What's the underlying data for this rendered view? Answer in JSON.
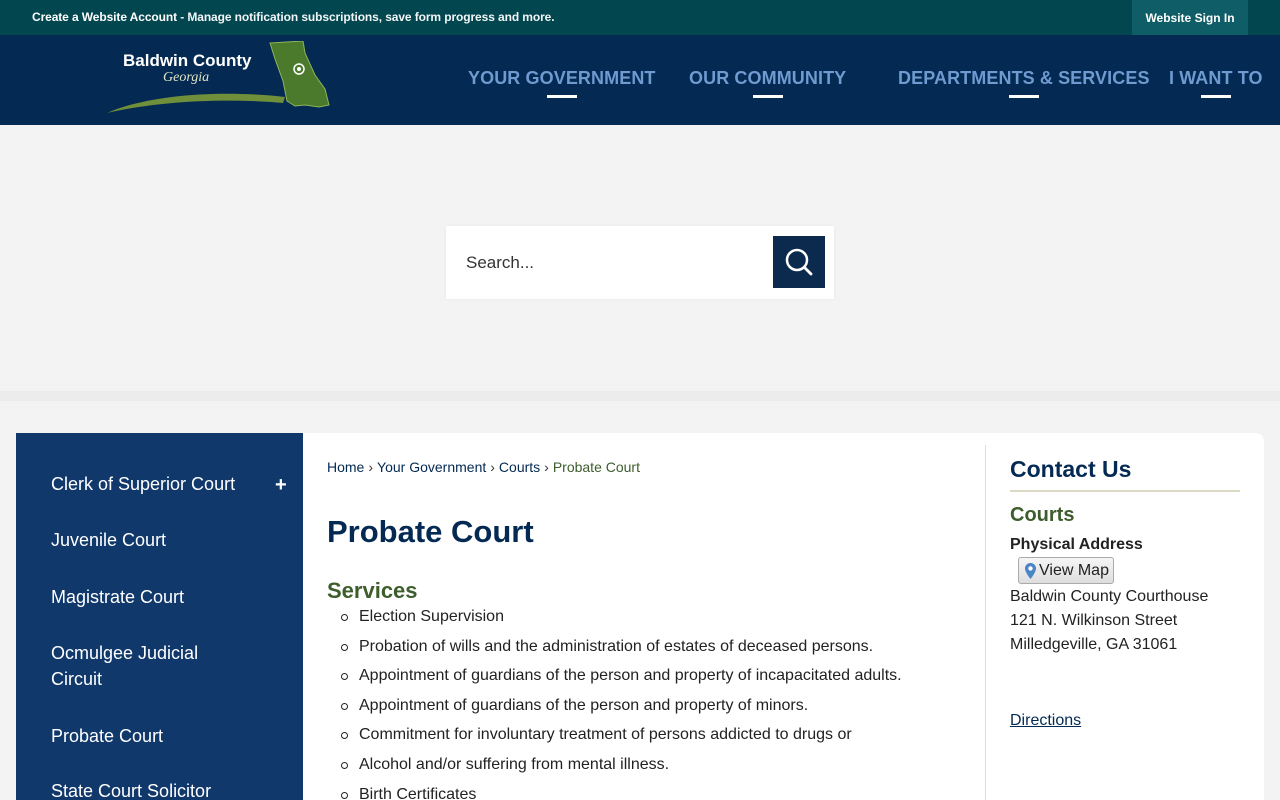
{
  "topbar": {
    "account_link": "Create a Website Account",
    "account_desc": " - Manage notification subscriptions, save form progress and more.",
    "signin": "Website Sign In"
  },
  "logo": {
    "line1": "Baldwin County",
    "line2": "Georgia"
  },
  "nav": {
    "items": [
      {
        "label": "YOUR GOVERNMENT"
      },
      {
        "label": "OUR COMMUNITY"
      },
      {
        "label": "DEPARTMENTS & SERVICES"
      },
      {
        "label": "I WANT TO"
      }
    ]
  },
  "search": {
    "placeholder": "Search..."
  },
  "sidebar": {
    "items": [
      {
        "label": "Clerk of Superior Court",
        "expandable": "+"
      },
      {
        "label": "Juvenile Court"
      },
      {
        "label": "Magistrate Court"
      },
      {
        "label": "Ocmulgee Judicial Circuit"
      },
      {
        "label": "Probate Court"
      },
      {
        "label": "State Court Solicitor"
      }
    ]
  },
  "breadcrumb": {
    "items": [
      "Home",
      "Your Government",
      "Courts"
    ],
    "separator": "›",
    "current": "Probate Court"
  },
  "page": {
    "title": "Probate Court",
    "section": "Services",
    "services": [
      "Election Supervision",
      "Probation of wills and the administration of estates of deceased persons.",
      "Appointment of guardians of the person and property of incapacitated adults.",
      "Appointment of guardians of the person and property of minors.",
      "Commitment for involuntary treatment of persons addicted to drugs or",
      "Alcohol and/or suffering from mental illness.",
      "Birth Certificates"
    ]
  },
  "contact": {
    "heading": "Contact Us",
    "department": "Courts",
    "address_label": "Physical Address",
    "map_button": "View Map",
    "address_lines": [
      "Baldwin County Courthouse",
      "121 N. Wilkinson Street",
      "Milledgeville, GA 31061"
    ],
    "directions": "Directions"
  },
  "colors": {
    "topbar": "#02464f",
    "header": "#042952",
    "nav_text": "#6f9bd1",
    "sidebar": "#10386b",
    "accent_green": "#3e5d2c"
  }
}
